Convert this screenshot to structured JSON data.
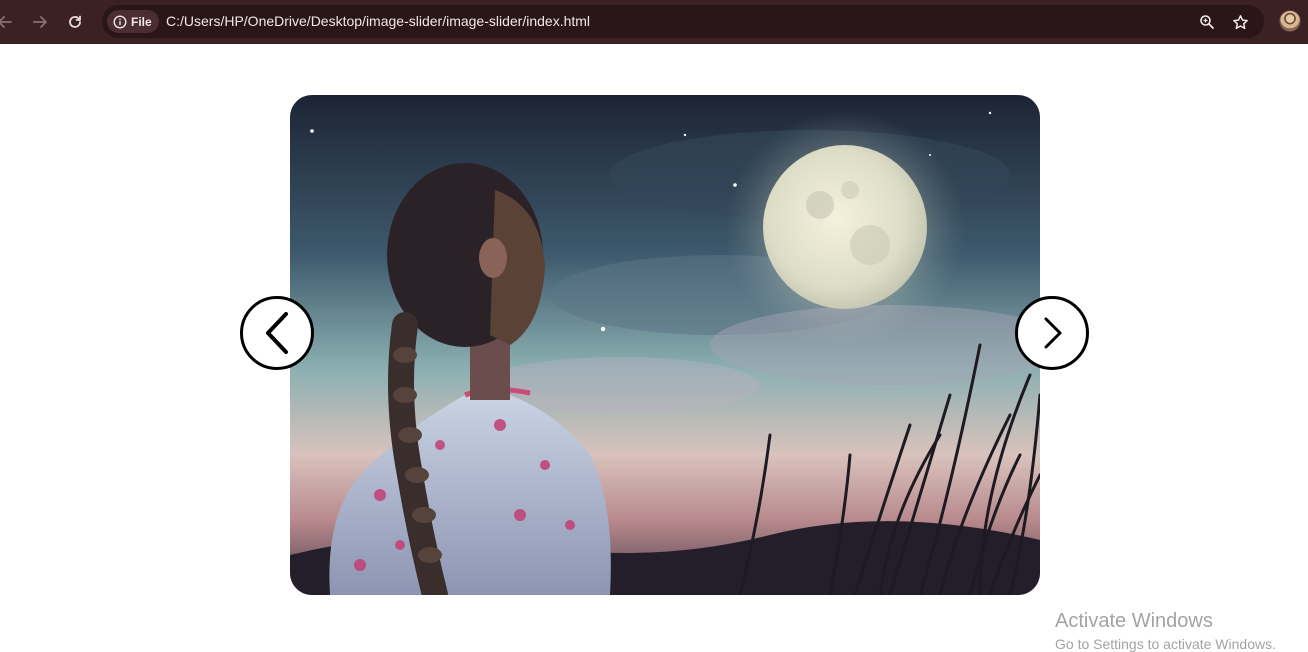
{
  "browser": {
    "site_chip_label": "File",
    "url": "C:/Users/HP/OneDrive/Desktop/image-slider/image-slider/index.html",
    "icons": [
      "back-arrow-icon",
      "forward-arrow-icon",
      "reload-icon",
      "info-icon",
      "zoom-icon",
      "star-icon"
    ]
  },
  "colors": {
    "toolbar_bg": "#3b2024",
    "omnibox_bg": "#2a1518",
    "page_bg": "#ffffff",
    "arrow_border": "#000000"
  },
  "slider": {
    "image_description": "girl looking at full moon",
    "controls": {
      "prev_icon": "chevron-left-icon",
      "next_icon": "chevron-right-icon"
    }
  },
  "watermark": {
    "title": "Activate Windows",
    "subtitle": "Go to Settings to activate Windows."
  }
}
